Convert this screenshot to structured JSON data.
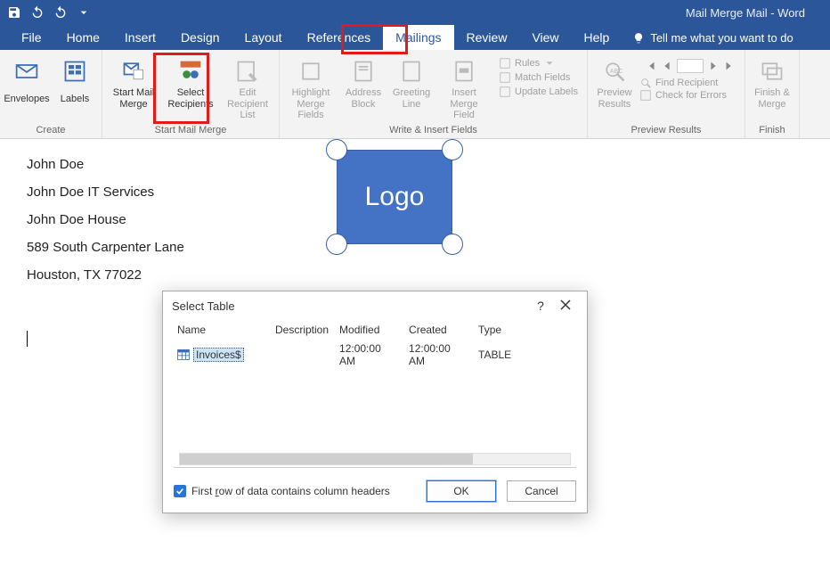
{
  "title": "Mail Merge Mail  -  Word",
  "tabs": {
    "file": "File",
    "home": "Home",
    "insert": "Insert",
    "design": "Design",
    "layout": "Layout",
    "references": "References",
    "mailings": "Mailings",
    "review": "Review",
    "view": "View",
    "help": "Help",
    "tellme": "Tell me what you want to do"
  },
  "ribbon": {
    "create": {
      "label": "Create",
      "envelopes": "Envelopes",
      "labels": "Labels"
    },
    "start": {
      "label": "Start Mail Merge",
      "startmm": "Start Mail\nMerge",
      "selectrec": "Select\nRecipients",
      "editrec": "Edit\nRecipient List"
    },
    "write": {
      "label": "Write & Insert Fields",
      "highlight": "Highlight\nMerge Fields",
      "address": "Address\nBlock",
      "greeting": "Greeting\nLine",
      "insertmf": "Insert Merge\nField",
      "rules": "Rules",
      "match": "Match Fields",
      "update": "Update Labels"
    },
    "preview": {
      "label": "Preview Results",
      "preview": "Preview\nResults",
      "find": "Find Recipient",
      "check": "Check for Errors"
    },
    "finish": {
      "label": "Finish",
      "finish": "Finish &\nMerge"
    }
  },
  "doc": {
    "l1": "John Doe",
    "l2": "John Doe IT Services",
    "l3": "John Doe House",
    "l4": "589 South Carpenter Lane",
    "l5": "Houston, TX 77022",
    "logo": "Logo"
  },
  "dialog": {
    "title": "Select Table",
    "help": "?",
    "cols": {
      "name": "Name",
      "desc": "Description",
      "mod": "Modified",
      "created": "Created",
      "type": "Type"
    },
    "row": {
      "name": "Invoices$",
      "mod": "12:00:00 AM",
      "created": "12:00:00 AM",
      "type": "TABLE"
    },
    "check_label_pre": "First ",
    "check_label_r": "r",
    "check_label_post": "ow of data contains column headers",
    "ok": "OK",
    "cancel": "Cancel"
  }
}
